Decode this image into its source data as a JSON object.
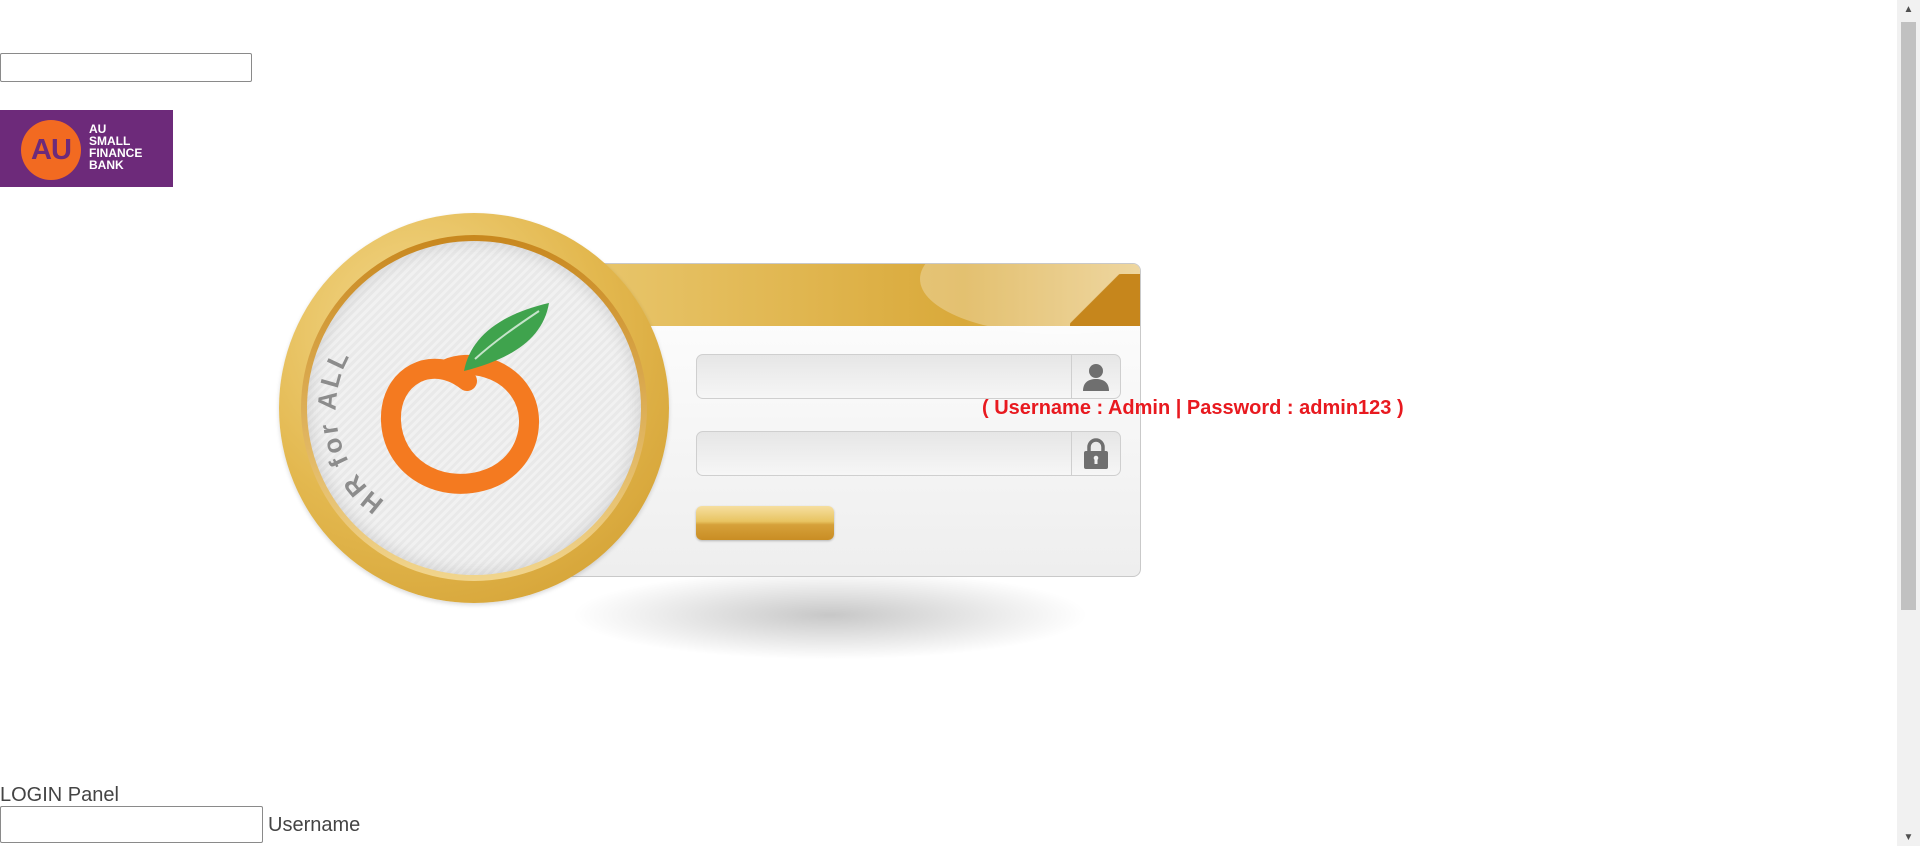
{
  "top": {
    "input_value": "",
    "input_placeholder": ""
  },
  "logo": {
    "initials": "AU",
    "lines": [
      "AU",
      "SMALL",
      "FINANCE",
      "BANK"
    ]
  },
  "login": {
    "username_value": "",
    "username_placeholder": "",
    "password_value": "",
    "password_placeholder": "",
    "hint": "( Username : Admin | Password : admin123 )",
    "button_label": ""
  },
  "emblem": {
    "text": "HR for ALL"
  },
  "bottom": {
    "panel_label": "LOGIN Panel",
    "username_label": "Username",
    "input_value": ""
  },
  "icons": [
    "user-icon",
    "lock-icon",
    "scroll-up-icon",
    "scroll-down-icon"
  ],
  "colors": {
    "hint": "#e8191f",
    "bank_purple": "#6d2a7a",
    "bank_orange": "#f26a21",
    "gold": "#e3b84f"
  }
}
